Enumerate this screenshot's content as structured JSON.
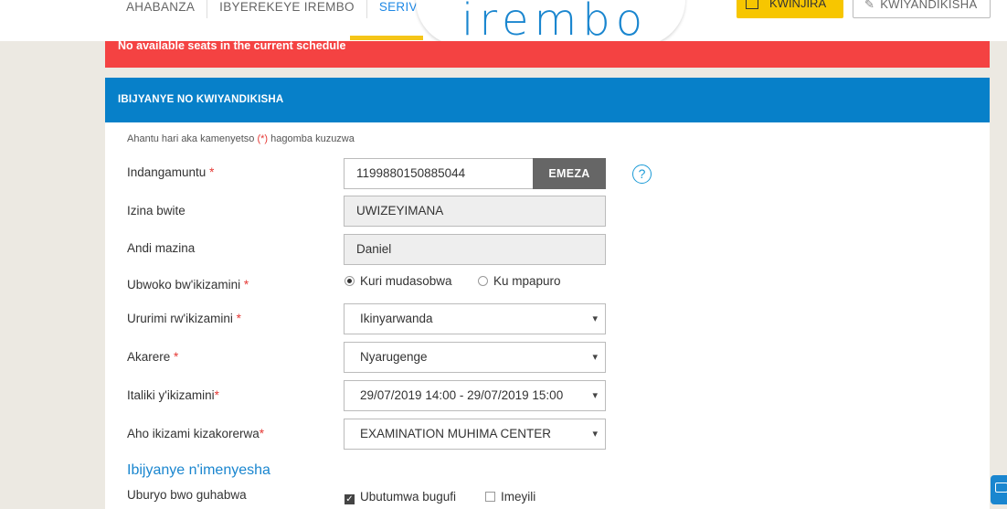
{
  "header": {
    "nav": [
      {
        "label": "AHABANZA",
        "active": false
      },
      {
        "label": "IBYEREKEYE IREMBO",
        "active": false
      },
      {
        "label": "SERIVISI K",
        "active": true
      }
    ],
    "logo": "irembo",
    "login_label": "KWINJIRA",
    "signup_label": "KWIYANDIKISHA"
  },
  "alert": {
    "text": "No available seats in the current schedule",
    "color": "#f44242"
  },
  "panel": {
    "title": "IBIJYANYE NO KWIYANDIKISHA",
    "note_before": "Ahantu hari aka kamenyetso ",
    "note_mark": "(*)",
    "note_after": " hagomba kuzuzwa",
    "fields": {
      "id": {
        "label": "Indangamuntu",
        "value": "1199880150885044",
        "button": "EMEZA",
        "help_icon": "question-icon"
      },
      "surname": {
        "label": "Izina bwite",
        "value": "UWIZEYIMANA"
      },
      "other_names": {
        "label": "Andi mazina",
        "value": "Daniel"
      },
      "exam_type": {
        "label": "Ubwoko bw'ikizamini",
        "options": [
          "Kuri mudasobwa",
          "Ku mpapuro"
        ],
        "selected": "Kuri mudasobwa"
      },
      "exam_language": {
        "label": "Ururimi rw'ikizamini",
        "value": "Ikinyarwanda"
      },
      "district": {
        "label": "Akarere",
        "value": "Nyarugenge"
      },
      "exam_date": {
        "label": "Italiki y'ikizamini",
        "value": "29/07/2019 14:00 - 29/07/2019 15:00"
      },
      "exam_center": {
        "label": "Aho ikizami kizakorerwa",
        "value": "EXAMINATION MUHIMA CENTER"
      }
    },
    "notifications": {
      "title": "Ibijyanye n'imenyesha",
      "label": "Uburyo bwo guhabwa",
      "options": [
        {
          "label": "Ubutumwa bugufi",
          "checked": true
        },
        {
          "label": "Imeyili",
          "checked": false
        }
      ]
    }
  },
  "colors": {
    "accent": "#0780c9",
    "brand_yellow": "#f7c600",
    "required": "#e53935"
  }
}
